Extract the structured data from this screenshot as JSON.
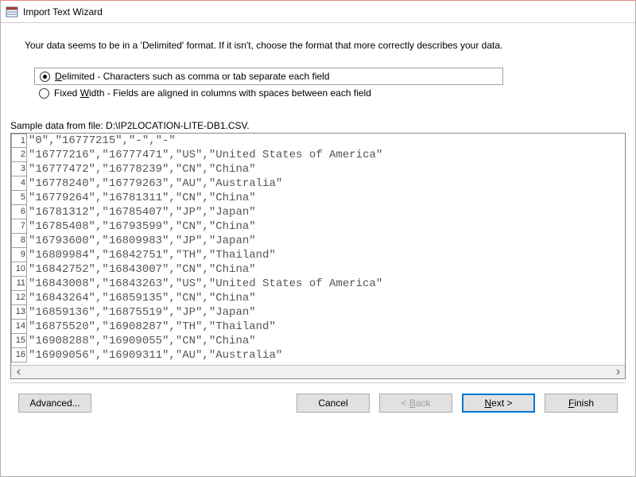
{
  "window": {
    "title": "Import Text Wizard"
  },
  "instruction": "Your data seems to be in a 'Delimited' format. If it isn't, choose the format that more correctly describes your data.",
  "options": {
    "delimited": {
      "key": "D",
      "rest": "elimited - Characters such as comma or tab separate each field",
      "selected": true
    },
    "fixed": {
      "prefix": "Fixed ",
      "key": "W",
      "rest": "idth - Fields are aligned in columns with spaces between each field",
      "selected": false
    }
  },
  "sample": {
    "label": "Sample data from file: D:\\IP2LOCATION-LITE-DB1.CSV.",
    "rows": [
      "\"0\",\"16777215\",\"-\",\"-\"",
      "\"16777216\",\"16777471\",\"US\",\"United States of America\"",
      "\"16777472\",\"16778239\",\"CN\",\"China\"",
      "\"16778240\",\"16779263\",\"AU\",\"Australia\"",
      "\"16779264\",\"16781311\",\"CN\",\"China\"",
      "\"16781312\",\"16785407\",\"JP\",\"Japan\"",
      "\"16785408\",\"16793599\",\"CN\",\"China\"",
      "\"16793600\",\"16809983\",\"JP\",\"Japan\"",
      "\"16809984\",\"16842751\",\"TH\",\"Thailand\"",
      "\"16842752\",\"16843007\",\"CN\",\"China\"",
      "\"16843008\",\"16843263\",\"US\",\"United States of America\"",
      "\"16843264\",\"16859135\",\"CN\",\"China\"",
      "\"16859136\",\"16875519\",\"JP\",\"Japan\"",
      "\"16875520\",\"16908287\",\"TH\",\"Thailand\"",
      "\"16908288\",\"16909055\",\"CN\",\"China\"",
      "\"16909056\",\"16909311\",\"AU\",\"Australia\""
    ]
  },
  "buttons": {
    "advanced": "Advanced...",
    "cancel": "Cancel",
    "back_lt": "< ",
    "back_key": "B",
    "back_rest": "ack",
    "next_key": "N",
    "next_rest": "ext >",
    "finish_key": "F",
    "finish_rest": "inish"
  }
}
